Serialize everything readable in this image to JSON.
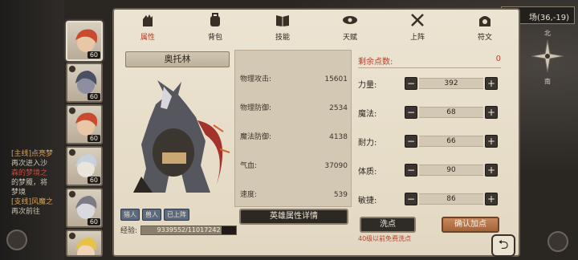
{
  "map": {
    "coordinates": "场(36,-19)",
    "north": "北",
    "south": "南"
  },
  "quests": [
    {
      "label": "[主线]点亮梦",
      "style": "hl"
    },
    {
      "label": "再次进入沙",
      "style": ""
    },
    {
      "label": "森的梦境之",
      "style": "red"
    },
    {
      "label": "的梦魇，将",
      "style": ""
    },
    {
      "label": "梦境",
      "style": ""
    },
    {
      "label": "[支线]风魔之",
      "style": "hl"
    },
    {
      "label": "再次前往",
      "style": ""
    }
  ],
  "tabs": [
    {
      "label": "属性",
      "icon": "fist-icon",
      "active": true
    },
    {
      "label": "背包",
      "icon": "backpack-icon",
      "active": false
    },
    {
      "label": "技能",
      "icon": "book-icon",
      "active": false
    },
    {
      "label": "天赋",
      "icon": "eye-icon",
      "active": false
    },
    {
      "label": "上阵",
      "icon": "crossed-swords-icon",
      "active": false
    },
    {
      "label": "符文",
      "icon": "rune-icon",
      "active": false
    }
  ],
  "characters": [
    {
      "level": "60",
      "hair": "#c94a2f",
      "active": true
    },
    {
      "level": "60",
      "hair": "#6a6f86",
      "active": false
    },
    {
      "level": "60",
      "hair": "#c94a2f",
      "active": false
    },
    {
      "level": "60",
      "hair": "#d8dde6",
      "active": false
    },
    {
      "level": "60",
      "hair": "#8f8f98",
      "active": false
    },
    {
      "level": "60",
      "hair": "#e6c246",
      "active": false
    }
  ],
  "hero": {
    "name": "奥托林",
    "tags": [
      "猎人",
      "兽人",
      "已上阵"
    ],
    "exp_label": "经验:",
    "exp_text": "9339552/11017242",
    "exp_fraction": 0.848
  },
  "stats": [
    {
      "label": "物理攻击:",
      "value": "15601"
    },
    {
      "label": "物理防御:",
      "value": "2534"
    },
    {
      "label": "魔法防御:",
      "value": "4138"
    },
    {
      "label": "气血:",
      "value": "37090"
    },
    {
      "label": "速度:",
      "value": "539"
    }
  ],
  "detail_button": "英雄属性详情",
  "points": {
    "remain_label": "剩余点数:",
    "remain_value": "0",
    "attributes": [
      {
        "label": "力量:",
        "value": "392"
      },
      {
        "label": "魔法:",
        "value": "68"
      },
      {
        "label": "耐力:",
        "value": "66"
      },
      {
        "label": "体质:",
        "value": "90"
      },
      {
        "label": "敏捷:",
        "value": "86"
      }
    ],
    "minus": "−",
    "plus": "+",
    "wash_button": "洗点",
    "confirm_button": "确认加点",
    "free_note": "40级以前免费洗点"
  },
  "back_label": "⮌",
  "colors": {
    "panel": "#ece4d2",
    "accent_red": "#c2331f",
    "confirm": "#b5704a"
  }
}
